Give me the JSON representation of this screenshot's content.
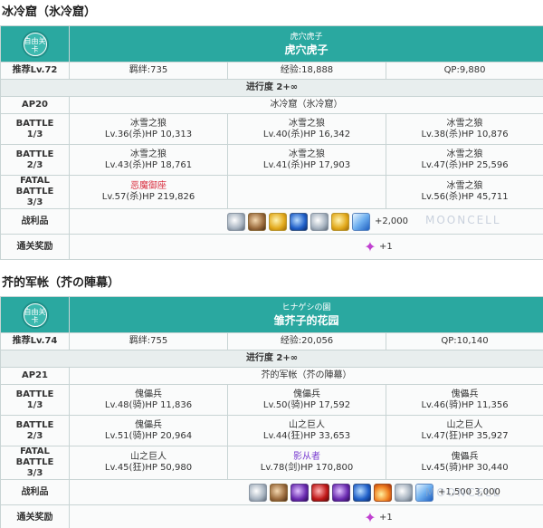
{
  "quests": [
    {
      "section_title": "冰冷窟（氷冷窟）",
      "logo_text": "自由关卡",
      "head_sub": "虎穴虎子",
      "head_main": "虎穴虎子",
      "rec_label": "推荐Lv.72",
      "bond": "羁绊:735",
      "exp": "经验:18,888",
      "qp": "QP:9,880",
      "progress": "进行度 2+∞",
      "ap_label": "AP20",
      "location": "冰冷窟（氷冷窟）",
      "battles": [
        {
          "label1": "BATTLE",
          "label2": "1/3",
          "enemies": [
            {
              "name": "冰雪之狼",
              "stats": "Lv.36(杀)HP 10,313"
            },
            {
              "name": "冰雪之狼",
              "stats": "Lv.40(杀)HP 16,342"
            },
            {
              "name": "冰雪之狼",
              "stats": "Lv.38(杀)HP 10,876"
            }
          ]
        },
        {
          "label1": "BATTLE",
          "label2": "2/3",
          "enemies": [
            {
              "name": "冰雪之狼",
              "stats": "Lv.43(杀)HP 18,761"
            },
            {
              "name": "冰雪之狼",
              "stats": "Lv.41(杀)HP 17,903"
            },
            {
              "name": "冰雪之狼",
              "stats": "Lv.47(杀)HP 25,596"
            }
          ]
        },
        {
          "label1": "FATAL BATTLE",
          "label2": "3/3",
          "enemies": [
            {
              "name": "恶魔御座",
              "stats": "Lv.57(杀)HP 219,826",
              "color": "red"
            },
            {
              "name": "",
              "stats": ""
            },
            {
              "name": "冰雪之狼",
              "stats": "Lv.56(杀)HP 45,711"
            }
          ]
        }
      ],
      "drops_label": "战利品",
      "drops": [
        "silver",
        "bronze",
        "gold",
        "blue",
        "silver",
        "gold",
        "crystal"
      ],
      "drops_qp": "+2,000",
      "reward_label": "通关奖励",
      "reward_value": "+1"
    },
    {
      "section_title": "芥的军帐（芥の陣幕）",
      "logo_text": "自由关卡",
      "head_sub": "ヒナゲシの園",
      "head_main": "雏芥子的花园",
      "rec_label": "推荐Lv.74",
      "bond": "羁绊:755",
      "exp": "经验:20,056",
      "qp": "QP:10,140",
      "progress": "进行度 2+∞",
      "ap_label": "AP21",
      "location": "芥的军帐（芥の陣幕）",
      "battles": [
        {
          "label1": "BATTLE",
          "label2": "1/3",
          "enemies": [
            {
              "name": "傀儡兵",
              "stats": "Lv.48(骑)HP 11,836"
            },
            {
              "name": "傀儡兵",
              "stats": "Lv.50(骑)HP 17,592"
            },
            {
              "name": "傀儡兵",
              "stats": "Lv.46(骑)HP 11,356"
            }
          ]
        },
        {
          "label1": "BATTLE",
          "label2": "2/3",
          "enemies": [
            {
              "name": "傀儡兵",
              "stats": "Lv.51(骑)HP 20,964"
            },
            {
              "name": "山之巨人",
              "stats": "Lv.44(狂)HP 33,653"
            },
            {
              "name": "山之巨人",
              "stats": "Lv.47(狂)HP 35,927"
            }
          ]
        },
        {
          "label1": "FATAL BATTLE",
          "label2": "3/3",
          "enemies": [
            {
              "name": "山之巨人",
              "stats": "Lv.45(狂)HP 50,980"
            },
            {
              "name": "影从者",
              "stats": "Lv.78(剑)HP 170,800",
              "color": "purple"
            },
            {
              "name": "傀儡兵",
              "stats": "Lv.45(骑)HP 30,440"
            }
          ]
        }
      ],
      "drops_label": "战利品",
      "drops": [
        "silver",
        "bronze",
        "purple",
        "red",
        "purple",
        "blue",
        "fire",
        "silver",
        "crystal"
      ],
      "drops_qp": "+1,500 3,000",
      "reward_label": "通关奖励",
      "reward_value": "+1"
    }
  ],
  "watermark": "MOONCELL",
  "colors": {
    "header_teal": "#2aa8a0",
    "label_bg": "#e8eeee",
    "boss_red": "#d93040",
    "shadow_purple": "#7a3ed1"
  }
}
